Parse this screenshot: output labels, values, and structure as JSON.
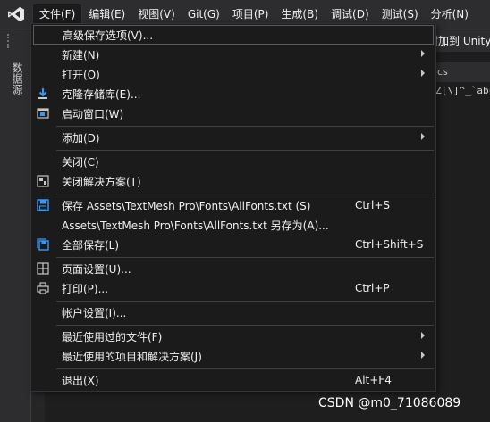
{
  "menubar": {
    "items": [
      {
        "label": "文件(F)"
      },
      {
        "label": "编辑(E)"
      },
      {
        "label": "视图(V)"
      },
      {
        "label": "Git(G)"
      },
      {
        "label": "项目(P)"
      },
      {
        "label": "生成(B)"
      },
      {
        "label": "调试(D)"
      },
      {
        "label": "测试(S)"
      },
      {
        "label": "分析(N)"
      }
    ]
  },
  "toolbar": {
    "right_text": "附加到 Unity"
  },
  "left_strip": {
    "tab_label": "数据源"
  },
  "document": {
    "tab_label": "cs",
    "code_line": "Z[\\]^_`abc"
  },
  "file_menu": {
    "items": [
      {
        "label": "高级保存选项(V)...",
        "shortcut": "",
        "submenu": false,
        "icon": ""
      },
      {
        "label": "新建(N)",
        "shortcut": "",
        "submenu": true,
        "icon": ""
      },
      {
        "label": "打开(O)",
        "shortcut": "",
        "submenu": true,
        "icon": ""
      },
      {
        "label": "克隆存储库(E)...",
        "shortcut": "",
        "submenu": false,
        "icon": "clone-icon"
      },
      {
        "label": "启动窗口(W)",
        "shortcut": "",
        "submenu": false,
        "icon": "start-window-icon"
      },
      {
        "label": "添加(D)",
        "shortcut": "",
        "submenu": true,
        "icon": ""
      },
      {
        "label": "关闭(C)",
        "shortcut": "",
        "submenu": false,
        "icon": ""
      },
      {
        "label": "关闭解决方案(T)",
        "shortcut": "",
        "submenu": false,
        "icon": "close-solution-icon"
      },
      {
        "label": "保存 Assets\\TextMesh Pro\\Fonts\\AllFonts.txt (S)",
        "shortcut": "Ctrl+S",
        "submenu": false,
        "icon": "save-icon"
      },
      {
        "label": "Assets\\TextMesh Pro\\Fonts\\AllFonts.txt 另存为(A)...",
        "shortcut": "",
        "submenu": false,
        "icon": ""
      },
      {
        "label": "全部保存(L)",
        "shortcut": "Ctrl+Shift+S",
        "submenu": false,
        "icon": "save-all-icon"
      },
      {
        "label": "页面设置(U)...",
        "shortcut": "",
        "submenu": false,
        "icon": "page-setup-icon"
      },
      {
        "label": "打印(P)...",
        "shortcut": "Ctrl+P",
        "submenu": false,
        "icon": "print-icon"
      },
      {
        "label": "帐户设置(I)...",
        "shortcut": "",
        "submenu": false,
        "icon": ""
      },
      {
        "label": "最近使用过的文件(F)",
        "shortcut": "",
        "submenu": true,
        "icon": ""
      },
      {
        "label": "最近使用的项目和解决方案(J)",
        "shortcut": "",
        "submenu": true,
        "icon": ""
      },
      {
        "label": "退出(X)",
        "shortcut": "Alt+F4",
        "submenu": false,
        "icon": ""
      }
    ]
  },
  "watermark": "CSDN @m0_71086089",
  "colors": {
    "accent": "#3399ff",
    "menu_bg": "#1b1b1c",
    "bar_bg": "#2d2d30"
  }
}
